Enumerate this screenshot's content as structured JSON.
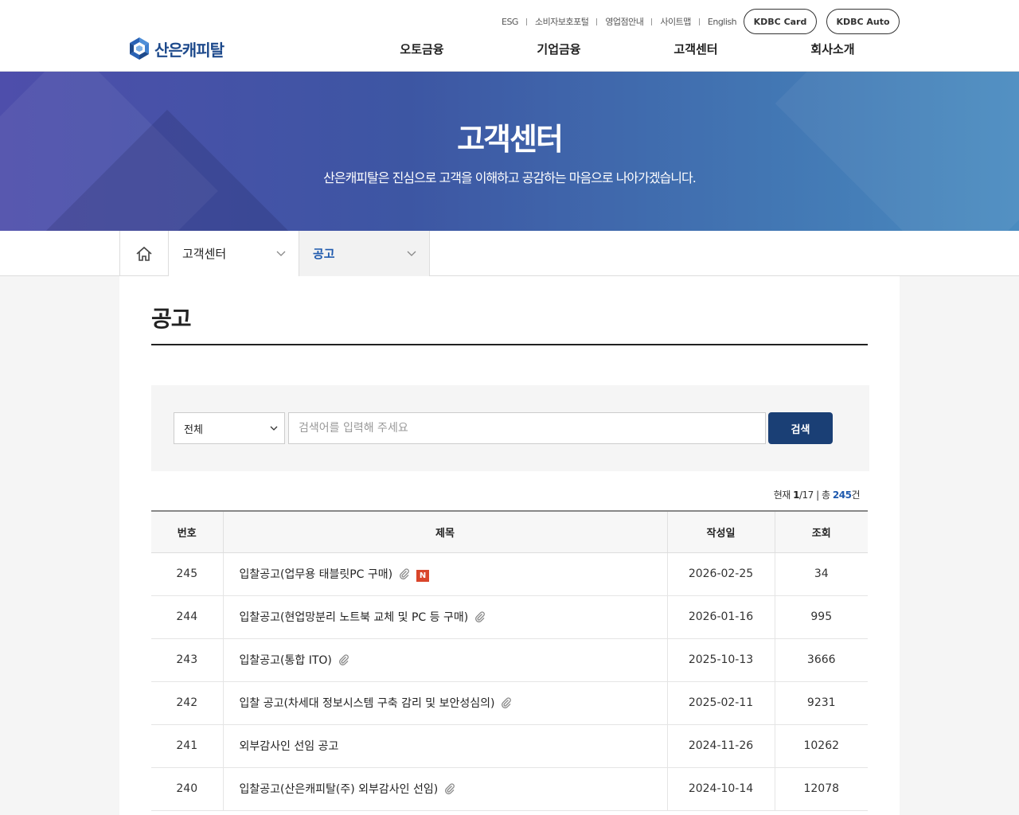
{
  "header": {
    "util_links": [
      "ESG",
      "소비자보호포털",
      "영업점안내",
      "사이트맵",
      "English"
    ],
    "pill_card": "KDBC Card",
    "pill_auto": "KDBC Auto",
    "logo_text": "산은캐피탈",
    "gnb": [
      "오토금융",
      "기업금융",
      "고객센터",
      "회사소개"
    ]
  },
  "banner": {
    "title": "고객센터",
    "subtitle": "산은캐피탈은 진심으로 고객을 이해하고 공감하는 마음으로 나아가겠습니다."
  },
  "lnb": {
    "depth1": "고객센터",
    "depth2": "공고"
  },
  "page": {
    "title": "공고"
  },
  "search": {
    "select_value": "전체",
    "placeholder": "검색어를 입력해 주세요",
    "button": "검색"
  },
  "count": {
    "prefix": "현재",
    "current": "1",
    "pages": "/17",
    "sep": "|",
    "total_label": "총",
    "total": "245",
    "unit": "건"
  },
  "table": {
    "headers": [
      "번호",
      "제목",
      "작성일",
      "조회"
    ],
    "rows": [
      {
        "no": "245",
        "title": "입찰공고(업무용 태블릿PC 구매)",
        "date": "2026-02-25",
        "views": "34",
        "attach": true,
        "new": "N"
      },
      {
        "no": "244",
        "title": "입찰공고(현업망분리 노트북 교체 및 PC 등 구매)",
        "date": "2026-01-16",
        "views": "995",
        "attach": true
      },
      {
        "no": "243",
        "title": "입찰공고(통합 ITO)",
        "date": "2025-10-13",
        "views": "3666",
        "attach": true
      },
      {
        "no": "242",
        "title": "입찰 공고(차세대 정보시스템 구축 감리 및 보안성심의)",
        "date": "2025-02-11",
        "views": "9231",
        "attach": true
      },
      {
        "no": "241",
        "title": "외부감사인 선임 공고",
        "date": "2024-11-26",
        "views": "10262",
        "attach": false
      },
      {
        "no": "240",
        "title": "입찰공고(산은캐피탈(주) 외부감사인 선임)",
        "date": "2024-10-14",
        "views": "12078",
        "attach": true
      }
    ]
  },
  "colors": {
    "brand": "#1e4a8c",
    "accent": "#1f5aae",
    "search_button": "#1a3f75",
    "new_badge": "#d9452a"
  },
  "icons": [
    "logo-mark-icon",
    "home-icon",
    "chevron-down-icon",
    "paperclip-icon"
  ]
}
